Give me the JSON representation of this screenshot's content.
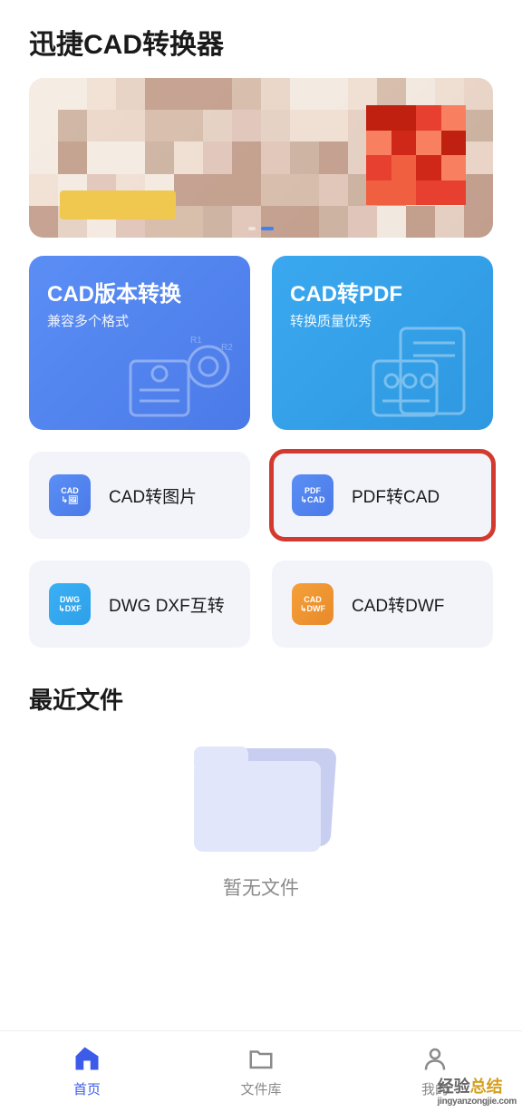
{
  "header": {
    "title": "迅捷CAD转换器"
  },
  "banner": {
    "button_label": "",
    "dots_count": 2,
    "active_dot": 1
  },
  "features": [
    {
      "title": "CAD版本转换",
      "subtitle": "兼容多个格式",
      "variant": "blue"
    },
    {
      "title": "CAD转PDF",
      "subtitle": "转换质量优秀",
      "variant": "cyan"
    }
  ],
  "tools": [
    {
      "icon_top": "CAD",
      "icon_bottom": "🖼",
      "label": "CAD转图片",
      "variant": "blue",
      "highlighted": false
    },
    {
      "icon_top": "PDF",
      "icon_bottom": "CAD",
      "label": "PDF转CAD",
      "variant": "blue",
      "highlighted": true
    },
    {
      "icon_top": "DWG",
      "icon_bottom": "DXF",
      "label": "DWG DXF互转",
      "variant": "cyan",
      "highlighted": false
    },
    {
      "icon_top": "CAD",
      "icon_bottom": "DWF",
      "label": "CAD转DWF",
      "variant": "orange",
      "highlighted": false
    }
  ],
  "recent": {
    "title": "最近文件",
    "empty_text": "暂无文件"
  },
  "nav": [
    {
      "label": "首页",
      "icon": "home",
      "active": true
    },
    {
      "label": "文件库",
      "icon": "folder",
      "active": false
    },
    {
      "label": "我的",
      "icon": "user",
      "active": false
    }
  ],
  "watermark": {
    "text_cn_1": "经验",
    "text_cn_2": "总结",
    "url": "jingyanzongjie.com"
  }
}
